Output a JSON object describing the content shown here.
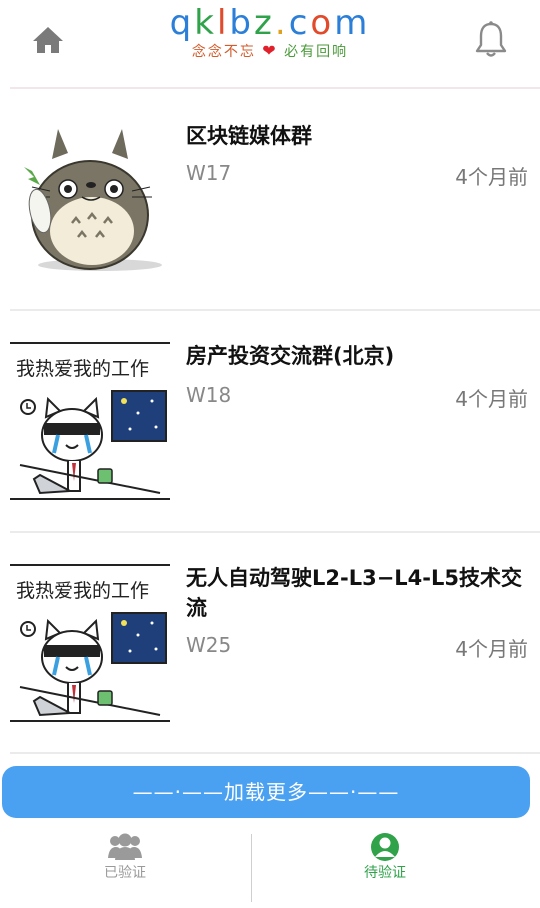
{
  "header": {
    "logo_text": "qklbz.com",
    "logo_slogan_left": "念念不忘",
    "logo_slogan_right": "必有回响",
    "home_icon": "home-icon",
    "bell_icon": "bell-icon"
  },
  "items": [
    {
      "title": "区块链媒体群",
      "code": "W17",
      "time": "4个月前",
      "thumb": "totoro-sticker"
    },
    {
      "title": "房产投资交流群(北京)",
      "code": "W18",
      "time": "4个月前",
      "thumb": "cat-working-sticker"
    },
    {
      "title": "无人自动驾驶L2-L3−L4-L5技术交流",
      "code": "W25",
      "time": "4个月前",
      "thumb": "cat-working-sticker"
    }
  ],
  "sticker_text": "我热爱我的工作",
  "load_more": "——·——加载更多——·——",
  "tabs": [
    {
      "label": "已验证",
      "icon": "group-icon",
      "active": false,
      "color": "#9a9a9a"
    },
    {
      "label": "待验证",
      "icon": "user-icon",
      "active": true,
      "color": "#2fa24a"
    }
  ],
  "colors": {
    "accent": "#4ba1f1",
    "active_tab": "#2fa24a"
  }
}
